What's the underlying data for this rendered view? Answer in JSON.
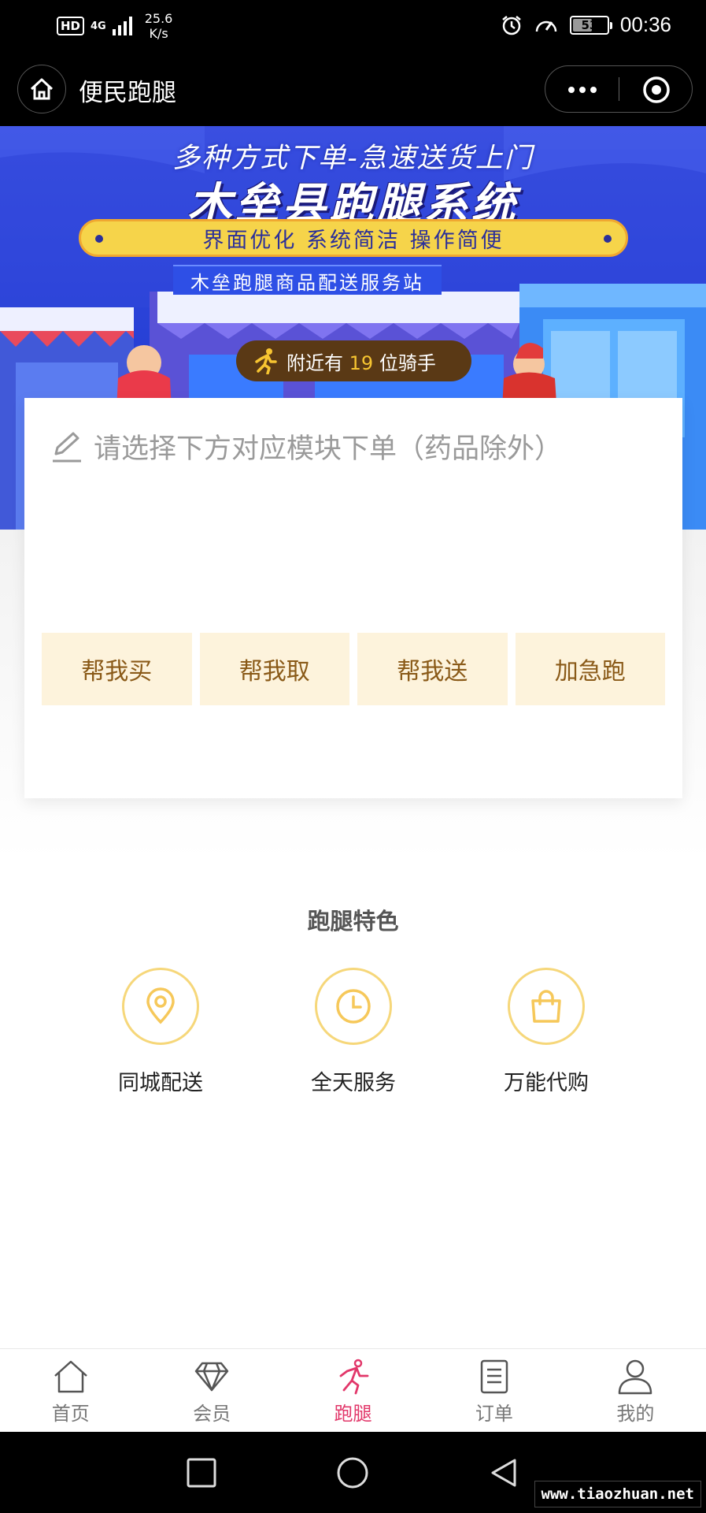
{
  "status_bar": {
    "hd": "HD",
    "network": "4G",
    "speed_value": "25.6",
    "speed_unit": "K/s",
    "battery": "53",
    "time": "00:36"
  },
  "nav": {
    "title": "便民跑腿"
  },
  "banner": {
    "line1": "多种方式下单-急速送货上门",
    "line2": "木垒县跑腿系统",
    "pill": "界面优化 系统简洁 操作简便",
    "line4": "木垒跑腿商品配送服务站",
    "riders_prefix": "附近有",
    "riders_count": "19",
    "riders_suffix": "位骑手"
  },
  "order": {
    "prompt": "请选择下方对应模块下单（药品除外）",
    "actions": [
      "帮我买",
      "帮我取",
      "帮我送",
      "加急跑"
    ]
  },
  "features": {
    "title": "跑腿特色",
    "items": [
      {
        "label": "同城配送",
        "icon": "location-pin-icon"
      },
      {
        "label": "全天服务",
        "icon": "clock-icon"
      },
      {
        "label": "万能代购",
        "icon": "shopping-bag-icon"
      }
    ],
    "accent_color": "#f6d77a"
  },
  "tabbar": {
    "items": [
      {
        "label": "首页",
        "icon": "home-icon"
      },
      {
        "label": "会员",
        "icon": "diamond-icon"
      },
      {
        "label": "跑腿",
        "icon": "runner-icon",
        "active": true
      },
      {
        "label": "订单",
        "icon": "order-list-icon"
      },
      {
        "label": "我的",
        "icon": "user-icon"
      }
    ],
    "active_color": "#e2376a"
  },
  "watermark": "www.tiaozhuan.net"
}
